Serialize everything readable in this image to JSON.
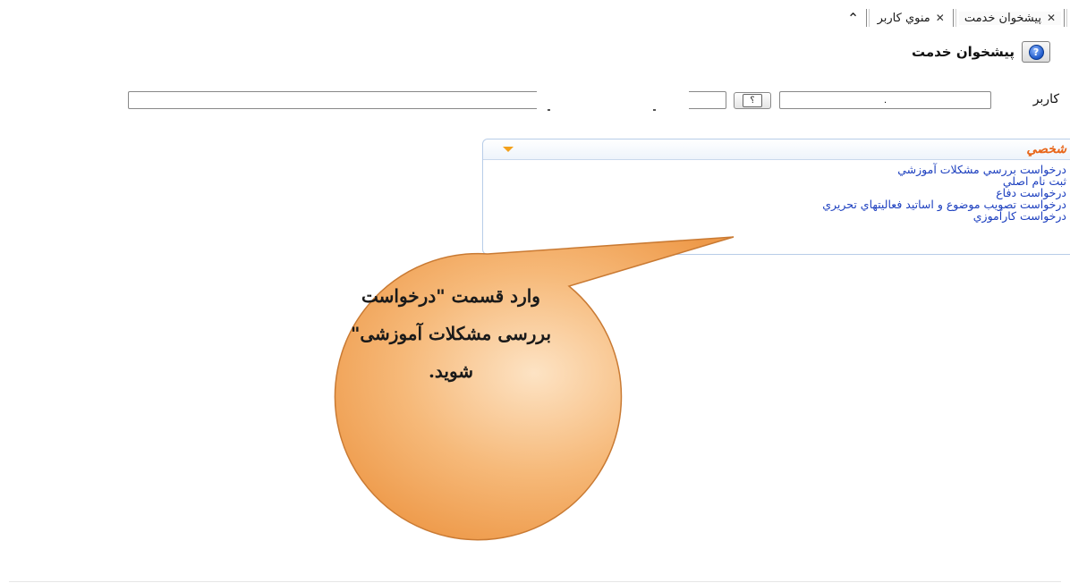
{
  "tabs": [
    {
      "label": "منوي كاربر",
      "close": "✕"
    },
    {
      "label": "پيشخوان خدمت",
      "close": "✕"
    }
  ],
  "header": {
    "title": "پيشخوان خدمت",
    "help_icon": "help-icon"
  },
  "user": {
    "label": "كاربر",
    "id_value": ".",
    "lookup_label": "؟",
    "name_value": ""
  },
  "panel": {
    "title": "شخصي",
    "items": [
      "درخواست بررسي مشكلات آموزشي",
      "ثبت نام اصلي",
      "درخواست دفاع",
      "درخواست تصويب موضوع و اساتيد فعاليتهاي تحريري",
      "درخواست كارآموزي"
    ]
  },
  "callout": {
    "line1": "وارد قسمت \"درخواست",
    "line2": "بررسی مشکلات آموزشی\"",
    "line3": "شوید."
  },
  "colors": {
    "link": "#1c3fbf",
    "panel_title": "#e8661a",
    "bubble_fill": "#f6b979",
    "bubble_stroke": "#c97a33"
  }
}
